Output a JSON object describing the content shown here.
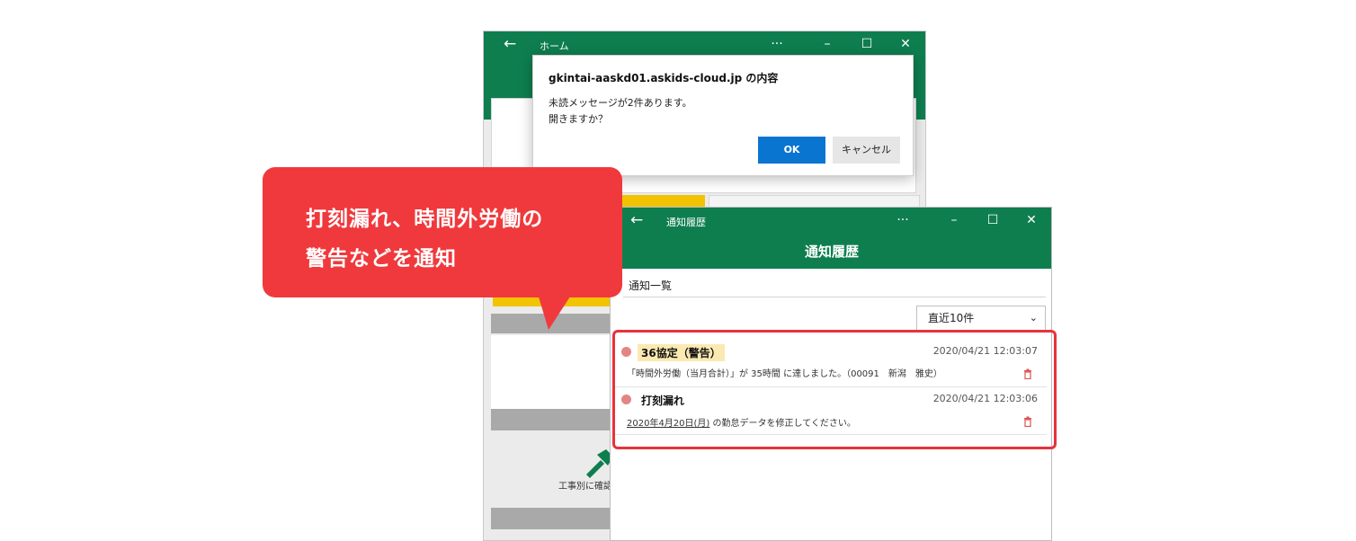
{
  "home_window": {
    "title": "ホーム",
    "back": "←",
    "more": "···",
    "minimize": "–",
    "maximize": "☐",
    "close": "✕",
    "tile_label": "工事別に確認"
  },
  "dialog": {
    "title": "gkintai-aaskd01.askids-cloud.jp の内容",
    "message_line1": "未読メッセージが2件あります。",
    "message_line2": "開きますか？",
    "ok_label": "OK",
    "cancel_label": "キャンセル"
  },
  "callout": {
    "line1": "打刻漏れ、時間外労働の",
    "line2": "警告などを通知"
  },
  "notif_window": {
    "title": "通知履歴",
    "back": "←",
    "more": "···",
    "minimize": "–",
    "maximize": "☐",
    "close": "✕",
    "header": "通知履歴",
    "list_heading": "通知一覧",
    "filter_value": "直近10件",
    "items": [
      {
        "title": "36協定（警告）",
        "time": "2020/04/21 12:03:07",
        "body": "「時間外労働（当月合計）」が 35時間 に達しました。（00091　新潟　雅史）"
      },
      {
        "title": "打刻漏れ",
        "time": "2020/04/21 12:03:06",
        "body_link": "2020年4月20日(月)",
        "body_rest": " の勤怠データを修正してください。"
      }
    ]
  },
  "colors": {
    "header_green": "#0e7e4f",
    "callout_red": "#f0393d",
    "ok_blue": "#0a74d1",
    "warn_highlight": "#fbe9b2"
  }
}
